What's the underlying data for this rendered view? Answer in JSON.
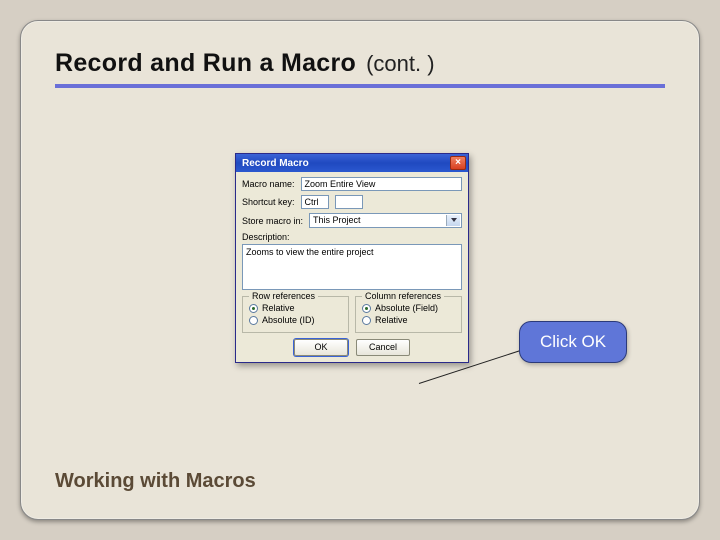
{
  "slide": {
    "title_main": "Record and Run a Macro",
    "title_cont": "(cont. )",
    "footer": "Working with Macros"
  },
  "dialog": {
    "title": "Record Macro",
    "labels": {
      "macro_name": "Macro name:",
      "shortcut": "Shortcut key:",
      "store_in": "Store macro in:",
      "description": "Description:"
    },
    "values": {
      "macro_name": "Zoom Entire View",
      "shortcut": "Ctrl",
      "store_in": "This Project",
      "description": "Zooms to view the entire project"
    },
    "groups": {
      "row": {
        "legend": "Row references",
        "opt1": "Relative",
        "opt2": "Absolute (ID)",
        "selected": 0
      },
      "col": {
        "legend": "Column references",
        "opt1": "Absolute (Field)",
        "opt2": "Relative",
        "selected": 0
      }
    },
    "buttons": {
      "ok": "OK",
      "cancel": "Cancel"
    }
  },
  "callout": {
    "text": "Click OK"
  }
}
